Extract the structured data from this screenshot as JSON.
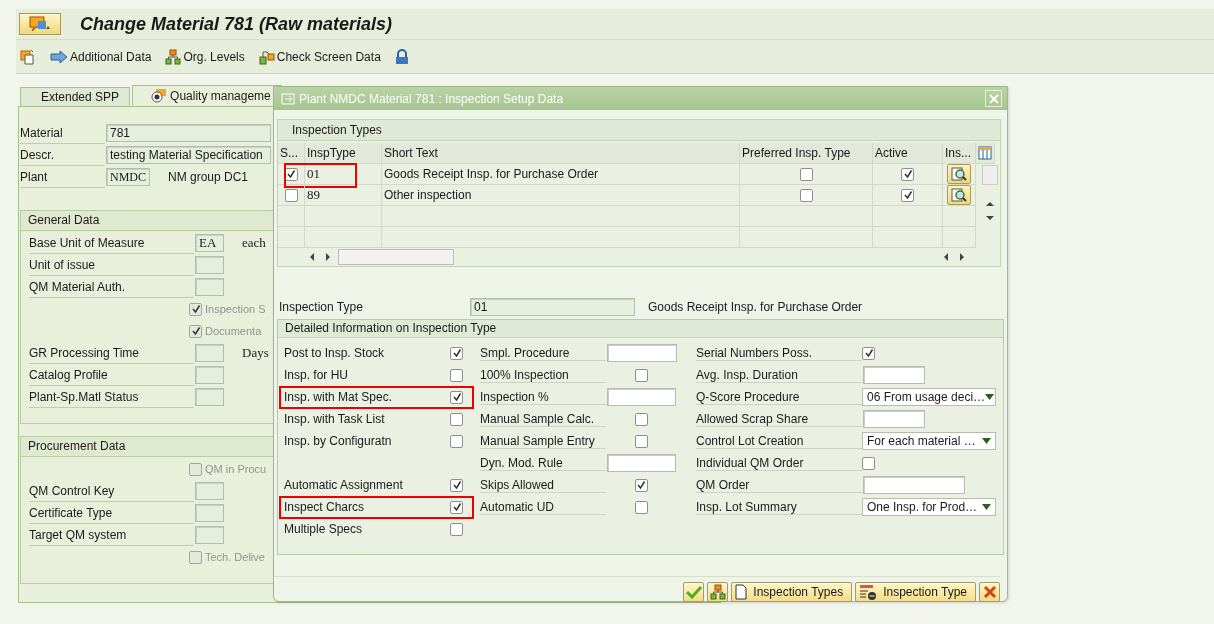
{
  "title": "Change Material 781 (Raw materials)",
  "toolbar": [
    {
      "kind": "new"
    },
    {
      "kind": "arrow",
      "label": "Additional Data"
    },
    {
      "kind": "org",
      "label": "Org. Levels"
    },
    {
      "kind": "check",
      "label": "Check Screen Data"
    },
    {
      "kind": "lock"
    }
  ],
  "tabs": [
    {
      "label": "Extended SPP",
      "selected": false
    },
    {
      "label": "Quality manageme",
      "selected": true
    }
  ],
  "header_fields": [
    {
      "label": "Material",
      "value": "781"
    },
    {
      "label": "Descr.",
      "value": "testing Material Specification"
    },
    {
      "label": "Plant",
      "value": "NMDC",
      "note": "NM group DC1"
    }
  ],
  "groups": [
    {
      "title": "General Data",
      "rows": [
        {
          "kind": "input",
          "label": "Base Unit of Measure",
          "value": "EA",
          "note": "each"
        },
        {
          "kind": "input",
          "label": "Unit of issue"
        },
        {
          "kind": "input",
          "label": "QM Material Auth."
        },
        {
          "kind": "checkbox",
          "label": "Inspection S",
          "checked": true,
          "disabled": true
        },
        {
          "kind": "checkbox",
          "label": "Documenta",
          "checked": true,
          "disabled": true
        },
        {
          "kind": "input",
          "label": "GR Processing Time",
          "note": "Days"
        },
        {
          "kind": "input",
          "label": "Catalog Profile"
        },
        {
          "kind": "input",
          "label": "Plant-Sp.Matl Status"
        }
      ]
    },
    {
      "title": "Procurement Data",
      "rows": [
        {
          "kind": "checkbox",
          "label": "QM in Procu",
          "checked": false,
          "disabled": true
        },
        {
          "kind": "input",
          "label": "QM Control Key"
        },
        {
          "kind": "input",
          "label": "Certificate Type"
        },
        {
          "kind": "input",
          "label": "Target QM system"
        },
        {
          "kind": "checkbox",
          "label": "Tech. Delive",
          "checked": false,
          "disabled": true
        }
      ]
    }
  ],
  "dialog": {
    "title": "Plant NMDC Material 781 : Inspection Setup Data",
    "section_title": "Inspection Types",
    "columns": [
      "S...",
      "InspType",
      "Short Text",
      "Preferred Insp. Type",
      "Active",
      "Ins..."
    ],
    "rows": [
      {
        "selected": true,
        "highlighted": true,
        "insp_type": "01",
        "short_text": "Goods Receipt Insp. for Purchase Order",
        "preferred": false,
        "active": true
      },
      {
        "selected": false,
        "highlighted": false,
        "insp_type": "89",
        "short_text": "Other inspection",
        "preferred": false,
        "active": true
      }
    ],
    "inspection_type": {
      "label": "Inspection Type",
      "value": "01",
      "text": "Goods Receipt Insp. for Purchase Order"
    },
    "detail_title": "Detailed Information on Inspection Type",
    "detail_columns": [
      [
        {
          "kind": "checkbox",
          "label": "Post to Insp. Stock",
          "checked": true,
          "highlighted": false
        },
        {
          "kind": "checkbox",
          "label": "Insp. for HU",
          "checked": false,
          "highlighted": false
        },
        {
          "kind": "checkbox",
          "label": "Insp. with Mat Spec.",
          "checked": true,
          "highlighted": true
        },
        {
          "kind": "checkbox",
          "label": "Insp. with Task List",
          "checked": false,
          "highlighted": false
        },
        {
          "kind": "checkbox",
          "label": "Insp. by Configuratn",
          "checked": false,
          "highlighted": false
        },
        {
          "kind": "spacer"
        },
        {
          "kind": "checkbox",
          "label": "Automatic Assignment",
          "checked": true,
          "highlighted": false
        },
        {
          "kind": "checkbox",
          "label": "Inspect Charcs",
          "checked": true,
          "highlighted": true
        },
        {
          "kind": "checkbox",
          "label": "Multiple Specs",
          "checked": false,
          "highlighted": false
        }
      ],
      [
        {
          "kind": "input",
          "label": "Smpl. Procedure"
        },
        {
          "kind": "checkbox",
          "label": "100% Inspection",
          "checked": false
        },
        {
          "kind": "input",
          "label": "Inspection %"
        },
        {
          "kind": "checkbox",
          "label": "Manual Sample Calc.",
          "checked": false
        },
        {
          "kind": "checkbox",
          "label": "Manual Sample Entry",
          "checked": false
        },
        {
          "kind": "input",
          "label": "Dyn. Mod. Rule"
        },
        {
          "kind": "checkbox",
          "label": "Skips Allowed",
          "checked": true
        },
        {
          "kind": "checkbox",
          "label": "Automatic UD",
          "checked": false
        }
      ],
      [
        {
          "kind": "checkbox",
          "label": "Serial Numbers Poss.",
          "checked": true
        },
        {
          "kind": "input",
          "label": "Avg. Insp. Duration"
        },
        {
          "kind": "dropdown",
          "label": "Q-Score Procedure",
          "value": "06 From usage deci…"
        },
        {
          "kind": "input",
          "label": "Allowed Scrap Share"
        },
        {
          "kind": "dropdown",
          "label": "Control Lot Creation",
          "value": "For each material …"
        },
        {
          "kind": "checkbox",
          "label": "Individual QM Order",
          "checked": false
        },
        {
          "kind": "input",
          "label": "QM Order"
        },
        {
          "kind": "dropdown",
          "label": "Insp. Lot Summary",
          "value": "One Insp. for Prod…"
        }
      ]
    ],
    "buttons": [
      {
        "kind": "confirm"
      },
      {
        "kind": "org"
      },
      {
        "kind": "doc",
        "label": "Inspection Types"
      },
      {
        "kind": "remove",
        "label": "Inspection Type"
      },
      {
        "kind": "cancel"
      }
    ]
  }
}
